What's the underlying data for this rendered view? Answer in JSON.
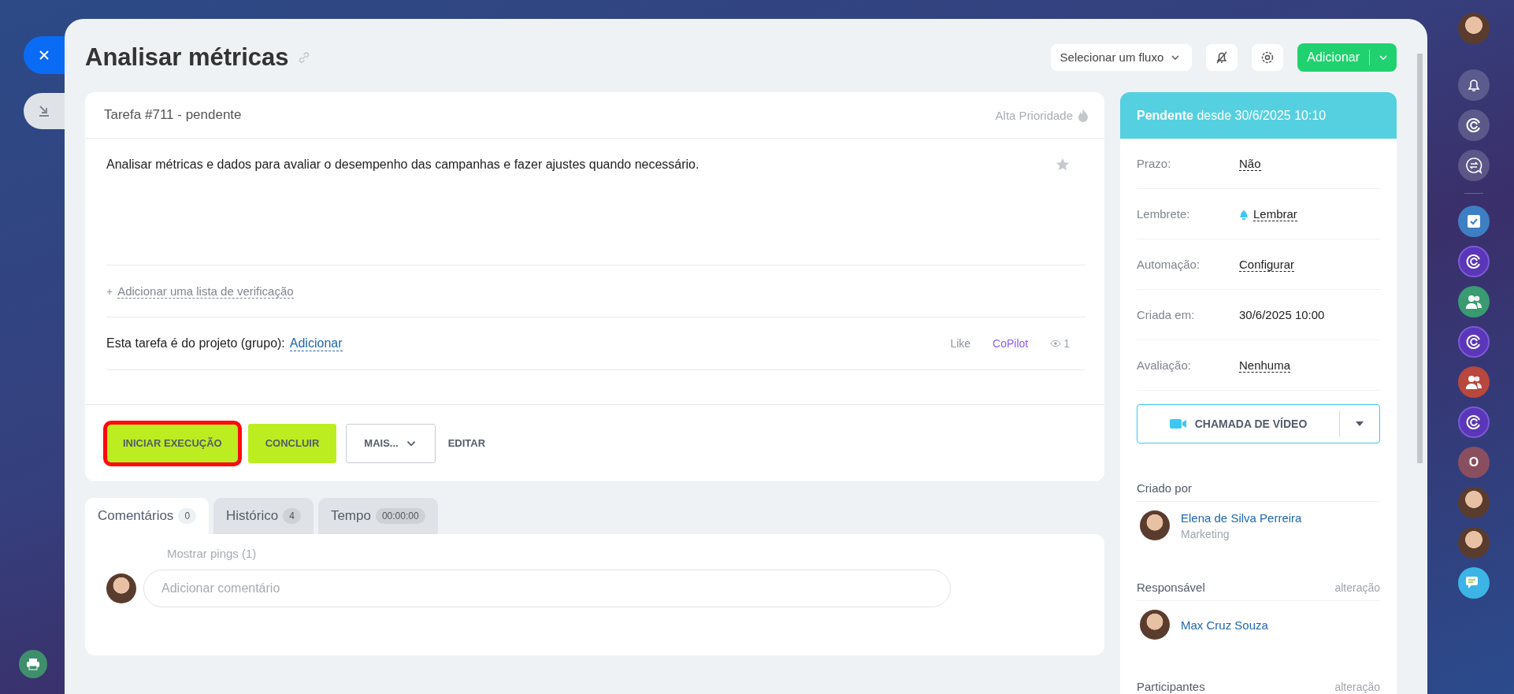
{
  "title": "Analisar métricas",
  "header_actions": {
    "flow_select": "Selecionar um fluxo",
    "add_button": "Adicionar"
  },
  "task": {
    "heading": "Tarefa #711 - pendente",
    "priority": {
      "label": "Alta Prioridade",
      "on": false
    },
    "favorite": false,
    "description": "Analisar métricas e dados para avaliar o desempenho das campanhas e fazer ajustes quando necessário.",
    "checklist_plus": "+",
    "checklist_link": "Adicionar uma lista de verificação",
    "project_label": "Esta tarefa é do projeto (grupo):",
    "project_link": "Adicionar",
    "like": "Like",
    "copilot": "CoPilot",
    "views": "1",
    "buttons": [
      {
        "label": "INICIAR EXECUÇÃO",
        "kind": "primary",
        "highlighted": true
      },
      {
        "label": "CONCLUIR",
        "kind": "primary",
        "highlighted": false
      },
      {
        "label": "MAIS...",
        "kind": "dropdown",
        "highlighted": false
      },
      {
        "label": "EDITAR",
        "kind": "link",
        "highlighted": false
      }
    ]
  },
  "tabs": [
    {
      "label": "Comentários",
      "count": "0",
      "selected": true
    },
    {
      "label": "Histórico",
      "count": "4",
      "selected": false
    },
    {
      "label": "Tempo",
      "count": "00:00:00",
      "selected": false
    }
  ],
  "comments": {
    "pings": "Mostrar pings (1)",
    "placeholder": "Adicionar comentário"
  },
  "status": {
    "state": "Pendente",
    "since": "desde 30/6/2025 10:10"
  },
  "fields": [
    {
      "label": "Prazo:",
      "value": "Não",
      "kind": "link"
    },
    {
      "label": "Lembrete:",
      "value": "Lembrar",
      "kind": "reminder"
    },
    {
      "label": "Automação:",
      "value": "Configurar",
      "kind": "link"
    },
    {
      "label": "Criada em:",
      "value": "30/6/2025 10:00",
      "kind": "text"
    },
    {
      "label": "Avaliação:",
      "value": "Nenhuma",
      "kind": "link"
    }
  ],
  "video_call": "CHAMADA DE VÍDEO",
  "people": [
    {
      "title": "Criado por",
      "name": "Elena de Silva Perreira",
      "department": "Marketing"
    },
    {
      "title": "Responsável",
      "action": "alteração",
      "name": "Max Cruz Souza"
    },
    {
      "title": "Participantes",
      "action": "alteração"
    }
  ],
  "right_bar": {
    "letter_badge": "O"
  }
}
